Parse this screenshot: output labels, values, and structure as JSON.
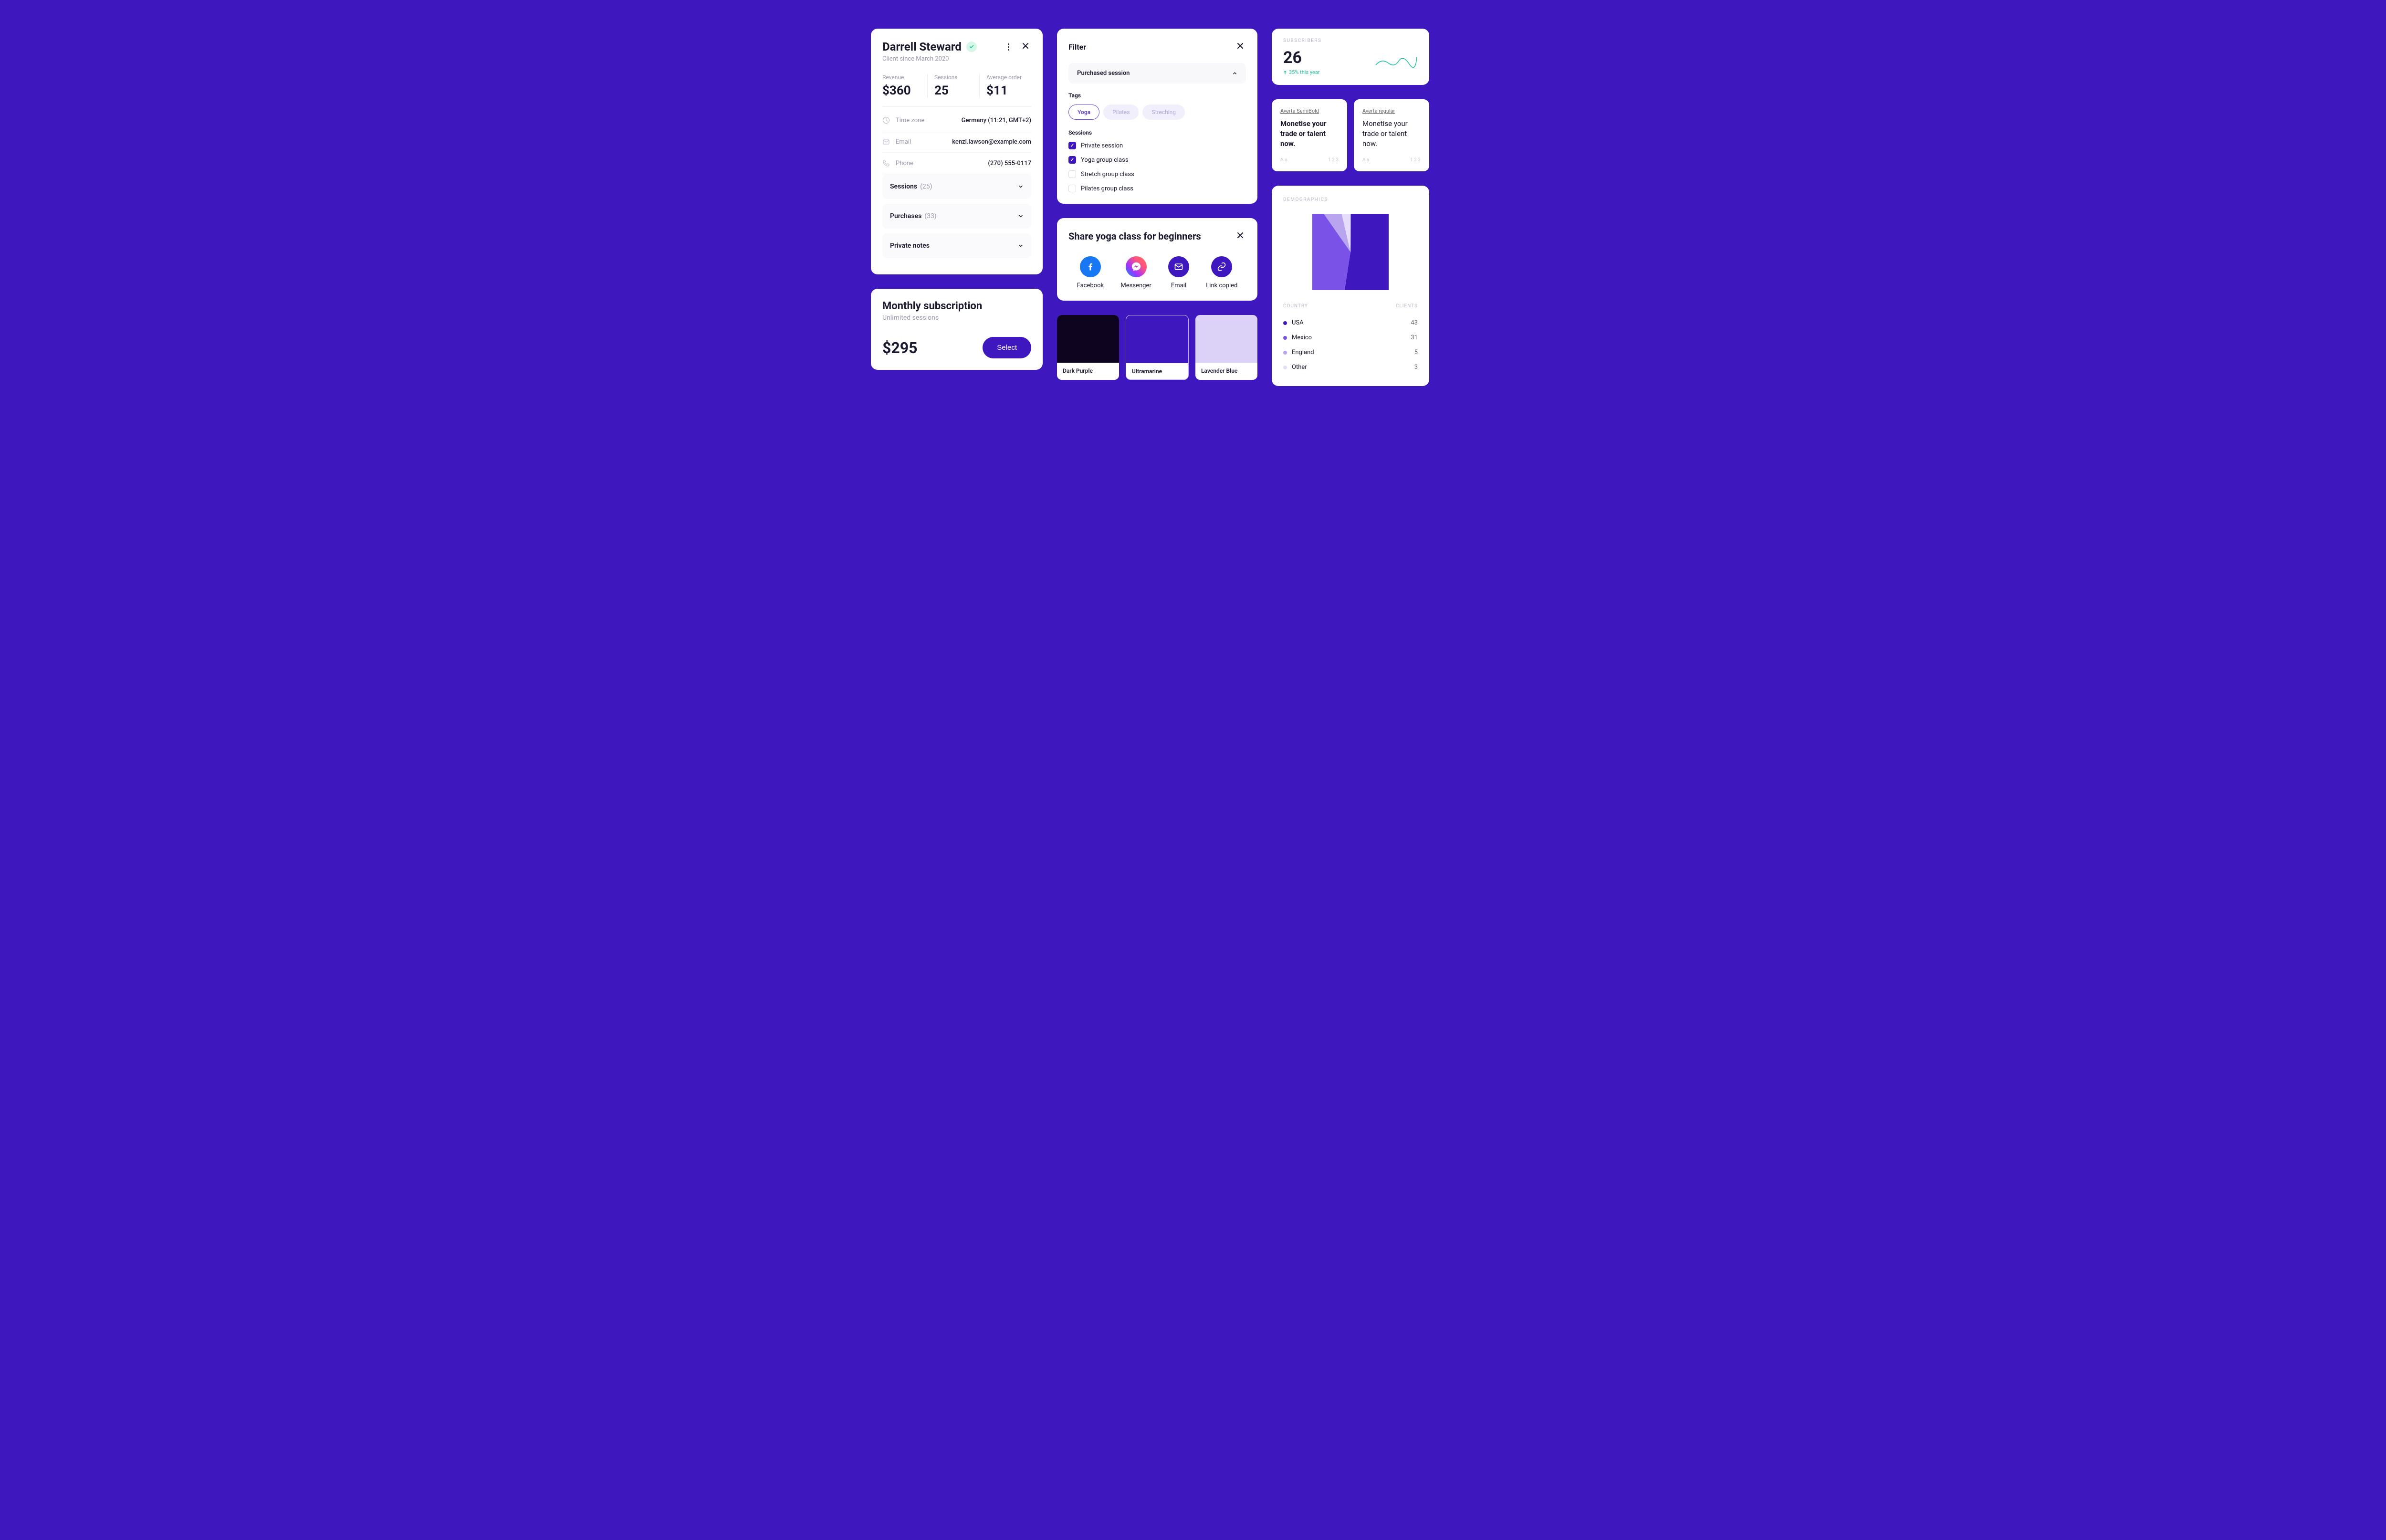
{
  "client": {
    "name": "Darrell Steward",
    "since": "Client since March 2020",
    "stats": {
      "revenue_label": "Revenue",
      "revenue_value": "$360",
      "sessions_label": "Sessions",
      "sessions_value": "25",
      "avg_label": "Average order",
      "avg_value": "$11"
    },
    "info": {
      "tz_label": "Time zone",
      "tz_value": "Germany (11:21, GMT+2)",
      "email_label": "Email",
      "email_value": "kenzi.lawson@example.com",
      "phone_label": "Phone",
      "phone_value": "(270) 555-0117"
    },
    "accordions": {
      "sessions_label": "Sessions",
      "sessions_count": "(25)",
      "purchases_label": "Purchases",
      "purchases_count": "(33)",
      "notes_label": "Private notes"
    }
  },
  "subscription": {
    "title": "Monthly subscription",
    "desc": "Unlimited sessions",
    "price": "$295",
    "button": "Select"
  },
  "filter": {
    "title": "Filter",
    "section": "Purchased session",
    "tags_label": "Tags",
    "tags": {
      "yoga": "Yoga",
      "pilates": "Pilates",
      "stretching": "Streching"
    },
    "sessions_label": "Sessions",
    "sessions": {
      "private": "Private session",
      "yoga_group": "Yoga group class",
      "stretch_group": "Stretch group class",
      "pilates_group": "Pilates group class"
    }
  },
  "share": {
    "title": "Share yoga class for beginners",
    "facebook": "Facebook",
    "messenger": "Messenger",
    "email": "Email",
    "link": "Link copied"
  },
  "swatches": {
    "dark": "Dark Purple",
    "ultra": "Ultramarine",
    "lavender": "Lavender Blue"
  },
  "subscribers": {
    "label": "SUBSCRIBERS",
    "value": "26",
    "trend": "35% this year"
  },
  "typo": {
    "semibold_name": "Averta SemiBold",
    "regular_name": "Averta regular",
    "sample": "Monetise your trade or talent now.",
    "aa": "A a",
    "nums": "1 2 3"
  },
  "demographics": {
    "label": "DEMOGRAPHICS",
    "country_header": "COUNTRY",
    "clients_header": "CLIENTS",
    "rows": {
      "usa": "USA",
      "usa_val": "43",
      "mexico": "Mexico",
      "mexico_val": "31",
      "england": "England",
      "england_val": "5",
      "other": "Other",
      "other_val": "3"
    }
  },
  "colors": {
    "dark_purple": "#0e0420",
    "ultramarine": "#3F17BE",
    "lavender": "#dcd1f7",
    "pie_usa": "#3F17BE",
    "pie_mexico": "#7b52e8",
    "pie_england": "#b9a4f0",
    "pie_other": "#e6ddfa"
  },
  "chart_data": {
    "type": "pie",
    "title": "Demographics",
    "categories": [
      "USA",
      "Mexico",
      "England",
      "Other"
    ],
    "values": [
      43,
      31,
      5,
      3
    ]
  }
}
